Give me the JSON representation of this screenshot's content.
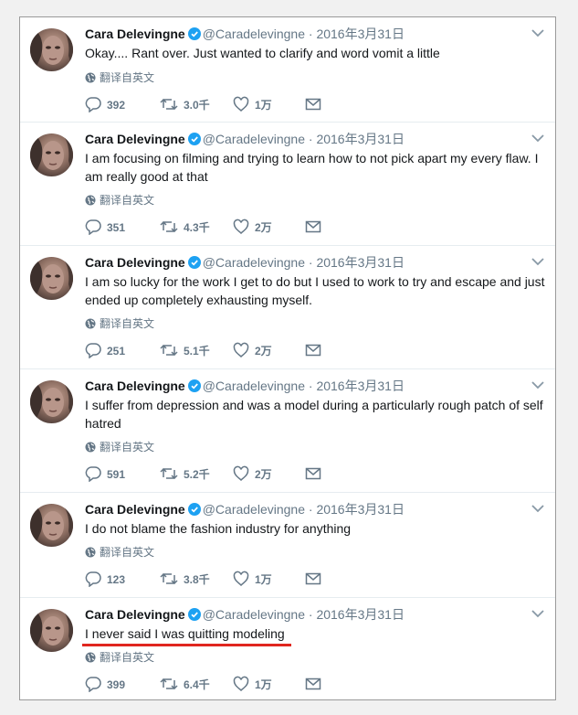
{
  "author": {
    "name": "Cara Delevingne",
    "handle": "@Caradelevingne",
    "separator": "·",
    "verified": true
  },
  "translate_label": "翻译自英文",
  "accent_colors": {
    "underline": "#e0261f",
    "verified": "#1da1f2",
    "muted": "#657786"
  },
  "tweets": [
    {
      "date": "2016年3月31日",
      "text": "Okay.... Rant over. Just wanted to clarify and word vomit a little",
      "replies": "392",
      "retweets": "3.0千",
      "likes": "1万"
    },
    {
      "date": "2016年3月31日",
      "text": "I am focusing on filming and trying to learn how to not pick apart my every flaw. I am really good at that",
      "replies": "351",
      "retweets": "4.3千",
      "likes": "2万"
    },
    {
      "date": "2016年3月31日",
      "text": "I am so lucky for the work I get to do but I used to work to try and escape and just ended up completely exhausting myself.",
      "replies": "251",
      "retweets": "5.1千",
      "likes": "2万"
    },
    {
      "date": "2016年3月31日",
      "text": "I suffer from depression and was a model during a particularly rough patch of self hatred",
      "replies": "591",
      "retweets": "5.2千",
      "likes": "2万"
    },
    {
      "date": "2016年3月31日",
      "text": "I do not blame the fashion industry for anything",
      "replies": "123",
      "retweets": "3.8千",
      "likes": "1万"
    },
    {
      "date": "2016年3月31日",
      "text": "I never said I was quitting modeling",
      "replies": "399",
      "retweets": "6.4千",
      "likes": "1万",
      "highlighted": true
    }
  ],
  "icons": {
    "reply": "reply-icon",
    "retweet": "retweet-icon",
    "like": "heart-icon",
    "message": "envelope-icon",
    "more": "chevron-down-icon",
    "translate": "globe-icon",
    "verified": "verified-badge-icon"
  }
}
